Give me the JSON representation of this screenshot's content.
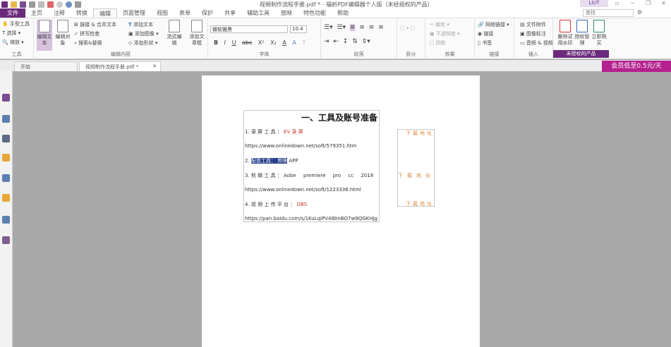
{
  "window": {
    "title": "视频制作流程手册.pdf * - 福昕PDF编辑器个人版（未经授权的产品）",
    "user": "LIUT"
  },
  "menu": {
    "items": [
      "文件",
      "主页",
      "注释",
      "转换",
      "编辑",
      "页面管理",
      "视图",
      "表单",
      "保护",
      "共享",
      "辅助工具",
      "放映",
      "特色功能",
      "帮助"
    ],
    "active": "编辑"
  },
  "search": {
    "placeholder": "查找"
  },
  "ribbon": {
    "tools": {
      "hand": "手型工具",
      "select": "选择",
      "zoom": "缩放",
      "label": "工具"
    },
    "edit": {
      "edit_text": "编辑文本",
      "edit_object": "编辑对象",
      "link_merge": "链接 & 合并文本",
      "spell": "拼写检查",
      "find_replace": "搜索&替换",
      "add_text": "添加文本",
      "add_image": "添加图像",
      "add_shape": "添加形状",
      "flow_edit": "流式编辑",
      "add_box": "添加文章框",
      "label": "编辑内容"
    },
    "font": {
      "name": "微软雅黑",
      "size": "10.4",
      "label": "字体",
      "buttons": [
        "B",
        "I",
        "U",
        "abc",
        "X²",
        "X₂",
        "A",
        "A",
        "T"
      ]
    },
    "paragraph": {
      "label": "段落"
    },
    "split": {
      "label": "拆分"
    },
    "effects": {
      "crop": "裁剪",
      "opacity": "不透明度",
      "shadow": "阴影",
      "label": "效果"
    },
    "links": {
      "web": "网络链接",
      "link": "链接",
      "bookmark": "书签",
      "label": "链接"
    },
    "insert": {
      "attach": "文件附件",
      "image": "图像标注",
      "av": "音频 & 视频",
      "label": "插入"
    },
    "license": {
      "remove": "删除试用水印",
      "manage": "授权管理",
      "buy": "立即购买",
      "label": "未授权的产品"
    }
  },
  "tabs": [
    {
      "label": "开始"
    },
    {
      "label": "视频制作流程手册.pdf *"
    }
  ],
  "promo": "会员低至0.5元/天",
  "document": {
    "heading": "一、工具及账号准备",
    "lines": [
      {
        "prefix": "1. 录 屏 工 具 ： ",
        "value": "EV 录 屏"
      },
      {
        "text": "https://www.onlinedown.net/soft/579351.htm"
      },
      {
        "prefix": "2. ",
        "selected": "配音工具： 剪映",
        "rest": " APP"
      },
      {
        "prefix": "3. 剪 辑 工 具 ： ",
        "value": "Aobe premiere pro cc 2018"
      },
      {
        "text": "https://www.onlinedown.net/soft/1223336.html"
      },
      {
        "prefix": "4. 视 频 上 传 平 台 ： ",
        "value": "OBS"
      },
      {
        "text": "https://pan.baidu.com/s/1KuLqiPV48bnBO7w9QGKHJg"
      }
    ],
    "download_labels": [
      "下载地址",
      "下载地址",
      "下载地址"
    ]
  },
  "colors": {
    "accent": "#6b2a7b",
    "promo": "#b5218e",
    "highlight": "#27408b",
    "download": "#e08a3c"
  }
}
